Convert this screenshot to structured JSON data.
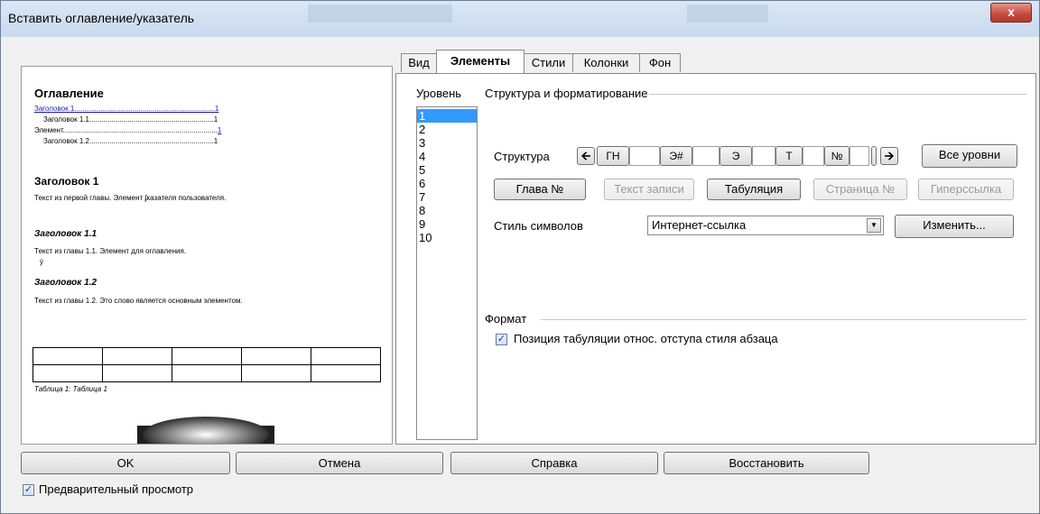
{
  "window": {
    "title": "Вставить оглавление/указатель",
    "close_label": "x"
  },
  "preview": {
    "heading": "Оглавление",
    "toc": [
      {
        "text": "Заголовок 1",
        "page": "1",
        "link": true,
        "indent": 0
      },
      {
        "text": "Заголовок 1.1",
        "page": "1",
        "link": false,
        "indent": 1
      },
      {
        "text": "Элемент",
        "page": "1",
        "link": false,
        "indent": 0
      },
      {
        "text": "Заголовок 1.2",
        "page": "1",
        "link": false,
        "indent": 1
      }
    ],
    "h1": "Заголовок 1",
    "h1_text": "Текст из первой главы. Элемент ʄказателя пользователя.",
    "h11": "Заголовок 1.1",
    "h11_text": "Текст из главы 1.1. Элемент для оглавления.",
    "h11_mark": "ÿ",
    "h12": "Заголовок 1.2",
    "h12_text": "Текст из главы 1.2. Это слово является основным элементом.",
    "caption": "Таблица 1: Таблица 1"
  },
  "tabs": [
    "Вид",
    "Элементы",
    "Стили",
    "Колонки",
    "Фон"
  ],
  "active_tab": "Элементы",
  "levels": {
    "label": "Уровень",
    "items": [
      "1",
      "2",
      "3",
      "4",
      "5",
      "6",
      "7",
      "8",
      "9",
      "10"
    ],
    "selected": "1"
  },
  "structure": {
    "group_label": "Структура и форматирование",
    "label": "Структура",
    "tokens": [
      "ГН",
      "Э#",
      "Э",
      "Т",
      "№"
    ],
    "all_levels": "Все уровни"
  },
  "insert_buttons": {
    "chapter": "Глава №",
    "entry_text": "Текст записи",
    "tab": "Табуляция",
    "page": "Страница №",
    "hyperlink": "Гиперссылка"
  },
  "char_style": {
    "label": "Стиль символов",
    "value": "Интернет-ссылка",
    "edit": "Изменить..."
  },
  "format": {
    "group_label": "Формат",
    "tab_position": "Позиция табуляции относ. отступа стиля абзаца",
    "tab_position_checked": true
  },
  "footer": {
    "ok": "OK",
    "cancel": "Отмена",
    "help": "Справка",
    "reset": "Восстановить",
    "preview_label": "Предварительный просмотр",
    "preview_checked": true
  }
}
